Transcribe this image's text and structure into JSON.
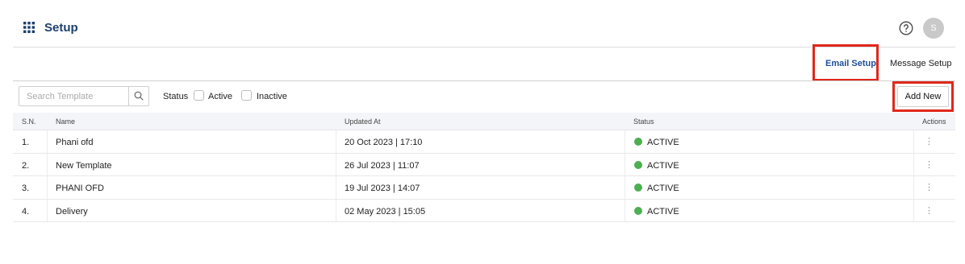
{
  "header": {
    "title": "Setup",
    "menu_icon": "grid-menu-icon",
    "help_icon": "help-circle-icon",
    "avatar_initial": "S"
  },
  "tabs": [
    {
      "label": "Email Setup",
      "active": true
    },
    {
      "label": "Message Setup",
      "active": false
    }
  ],
  "filters": {
    "search_placeholder": "Search Template",
    "status_label": "Status",
    "active_label": "Active",
    "inactive_label": "Inactive",
    "active_checked": false,
    "inactive_checked": false
  },
  "add_button_label": "Add New",
  "table": {
    "headers": {
      "sn": "S.N.",
      "name": "Name",
      "updated": "Updated At",
      "status": "Status",
      "actions": "Actions"
    },
    "rows": [
      {
        "sn": "1.",
        "name": "Phani ofd",
        "updated": "20 Oct 2023 | 17:10",
        "status": "ACTIVE"
      },
      {
        "sn": "2.",
        "name": "New Template",
        "updated": "26 Jul 2023 | 11:07",
        "status": "ACTIVE"
      },
      {
        "sn": "3.",
        "name": "PHANI OFD",
        "updated": "19 Jul 2023 | 14:07",
        "status": "ACTIVE"
      },
      {
        "sn": "4.",
        "name": "Delivery",
        "updated": "02 May 2023 | 15:05",
        "status": "ACTIVE"
      }
    ]
  },
  "colors": {
    "accent": "#1d4f9a",
    "title": "#1d3f6e",
    "highlight": "#e0271b",
    "status_active": "#4caf50"
  }
}
